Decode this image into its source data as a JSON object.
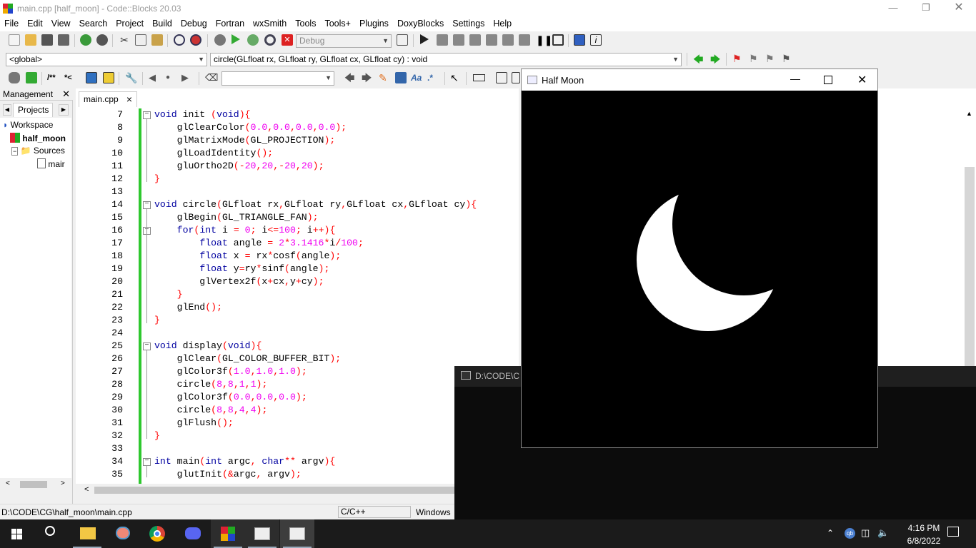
{
  "window": {
    "title": "main.cpp [half_moon] - Code::Blocks 20.03"
  },
  "menu": [
    "File",
    "Edit",
    "View",
    "Search",
    "Project",
    "Build",
    "Debug",
    "Fortran",
    "wxSmith",
    "Tools",
    "Tools+",
    "Plugins",
    "DoxyBlocks",
    "Settings",
    "Help"
  ],
  "toolbar": {
    "build_target": "Debug",
    "scope": "<global>",
    "function": "circle(GLfloat rx, GLfloat ry, GLfloat cx, GLfloat cy) : void",
    "search_value": ""
  },
  "management": {
    "title": "Management",
    "tab": "Projects",
    "tree": [
      "Workspace",
      "half_moon",
      "Sources",
      "mair"
    ]
  },
  "editor": {
    "tab": "main.cpp",
    "close": "×",
    "lines": [
      {
        "n": "7",
        "t": "void init (void){"
      },
      {
        "n": "8",
        "t": "    glClearColor(0.0,0.0,0.0,0.0);"
      },
      {
        "n": "9",
        "t": "    glMatrixMode(GL_PROJECTION);"
      },
      {
        "n": "10",
        "t": "    glLoadIdentity();"
      },
      {
        "n": "11",
        "t": "    gluOrtho2D(-20,20,-20,20);"
      },
      {
        "n": "12",
        "t": "}"
      },
      {
        "n": "13",
        "t": ""
      },
      {
        "n": "14",
        "t": "void circle(GLfloat rx,GLfloat ry,GLfloat cx,GLfloat cy){"
      },
      {
        "n": "15",
        "t": "    glBegin(GL_TRIANGLE_FAN);"
      },
      {
        "n": "16",
        "t": "    for(int i = 0; i<=100; i++){"
      },
      {
        "n": "17",
        "t": "        float angle = 2*3.1416*i/100;"
      },
      {
        "n": "18",
        "t": "        float x = rx*cosf(angle);"
      },
      {
        "n": "19",
        "t": "        float y=ry*sinf(angle);"
      },
      {
        "n": "20",
        "t": "        glVertex2f(x+cx,y+cy);"
      },
      {
        "n": "21",
        "t": "    }"
      },
      {
        "n": "22",
        "t": "    glEnd();"
      },
      {
        "n": "23",
        "t": "}"
      },
      {
        "n": "24",
        "t": ""
      },
      {
        "n": "25",
        "t": "void display(void){"
      },
      {
        "n": "26",
        "t": "    glClear(GL_COLOR_BUFFER_BIT);"
      },
      {
        "n": "27",
        "t": "    glColor3f(1.0,1.0,1.0);"
      },
      {
        "n": "28",
        "t": "    circle(8,8,1,1);"
      },
      {
        "n": "29",
        "t": "    glColor3f(0.0,0.0,0.0);"
      },
      {
        "n": "30",
        "t": "    circle(8,8,4,4);"
      },
      {
        "n": "31",
        "t": "    glFlush();"
      },
      {
        "n": "32",
        "t": "}"
      },
      {
        "n": "33",
        "t": ""
      },
      {
        "n": "34",
        "t": "int main(int argc, char** argv){"
      },
      {
        "n": "35",
        "t": "    glutInit(&argc, argv);"
      }
    ]
  },
  "gl_window": {
    "title": "Half Moon"
  },
  "console": {
    "title": "D:\\CODE\\CG"
  },
  "status": {
    "path": "D:\\CODE\\CG\\half_moon\\main.cpp",
    "language": "C/C++",
    "eol": "Windows"
  },
  "taskbar": {
    "time": "4:16 PM",
    "date": "6/8/2022"
  },
  "colors": {
    "change_bar": "#2ec82e",
    "keyword": "#0000a0",
    "number": "#f000f0",
    "operator": "#ff0000"
  }
}
